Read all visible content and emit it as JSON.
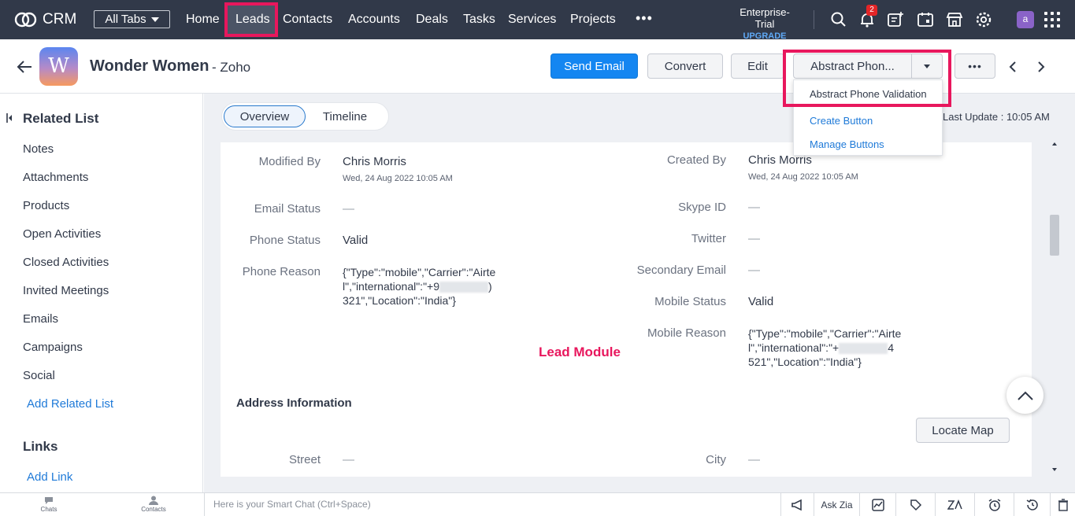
{
  "nav": {
    "logo": "CRM",
    "all_tabs": "All Tabs",
    "items": [
      "Home",
      "Leads",
      "Contacts",
      "Accounts",
      "Deals",
      "Tasks",
      "Services",
      "Projects"
    ],
    "more": "•••",
    "trial_label": "Enterprise-Trial",
    "upgrade": "UPGRADE",
    "notification_count": "2",
    "avatar_letter": "a"
  },
  "record": {
    "avatar_letter": "W",
    "name": "Wonder Women",
    "company": "- Zoho",
    "buttons": {
      "send_email": "Send Email",
      "convert": "Convert",
      "edit": "Edit",
      "custom": "Abstract Phon...",
      "more": "•••"
    },
    "dropdown": {
      "items": [
        "Abstract Phone Validation",
        "Create Button",
        "Manage Buttons"
      ]
    }
  },
  "sidebar": {
    "related_title": "Related List",
    "items": [
      "Notes",
      "Attachments",
      "Products",
      "Open Activities",
      "Closed Activities",
      "Invited Meetings",
      "Emails",
      "Campaigns",
      "Social"
    ],
    "add_related": "Add Related List",
    "links_title": "Links",
    "add_link": "Add Link"
  },
  "main": {
    "tabs": [
      "Overview",
      "Timeline"
    ],
    "last_update": "Last Update : 10:05 AM",
    "annotation": "Lead Module",
    "section_address": "Address Information",
    "locate_map": "Locate Map",
    "dash": "—",
    "left_fields": {
      "modified_by": {
        "label": "Modified By",
        "value": "Chris Morris",
        "sub": "Wed, 24 Aug 2022 10:05 AM"
      },
      "email_status": {
        "label": "Email Status"
      },
      "phone_status": {
        "label": "Phone Status",
        "value": "Valid"
      },
      "phone_reason": {
        "label": "Phone Reason",
        "line1": "{\"Type\":\"mobile\",\"Carrier\":\"Airte",
        "line2a": "l\",\"international\":\"+9",
        "line2b": ")",
        "line3": "321\",\"Location\":\"India\"}"
      },
      "street": {
        "label": "Street"
      }
    },
    "right_fields": {
      "created_by": {
        "label": "Created By",
        "value": "Chris Morris",
        "sub": "Wed, 24 Aug 2022 10:05 AM"
      },
      "skype_id": {
        "label": "Skype ID"
      },
      "twitter": {
        "label": "Twitter"
      },
      "secondary_email": {
        "label": "Secondary Email"
      },
      "mobile_status": {
        "label": "Mobile Status",
        "value": "Valid"
      },
      "mobile_reason": {
        "label": "Mobile Reason",
        "line1": "{\"Type\":\"mobile\",\"Carrier\":\"Airte",
        "line2a": "l\",\"international\":\"+",
        "line2b": "4",
        "line3": "521\",\"Location\":\"India\"}"
      },
      "city": {
        "label": "City"
      }
    }
  },
  "footer": {
    "chats": "Chats",
    "contacts": "Contacts",
    "smart_chat": "Here is your Smart Chat (Ctrl+Space)",
    "ask_zia": "Ask Zia"
  },
  "colors": {
    "nav_bg": "#313949",
    "highlight": "#e8175d",
    "primary": "#1486f1",
    "link": "#1f7ad8"
  }
}
